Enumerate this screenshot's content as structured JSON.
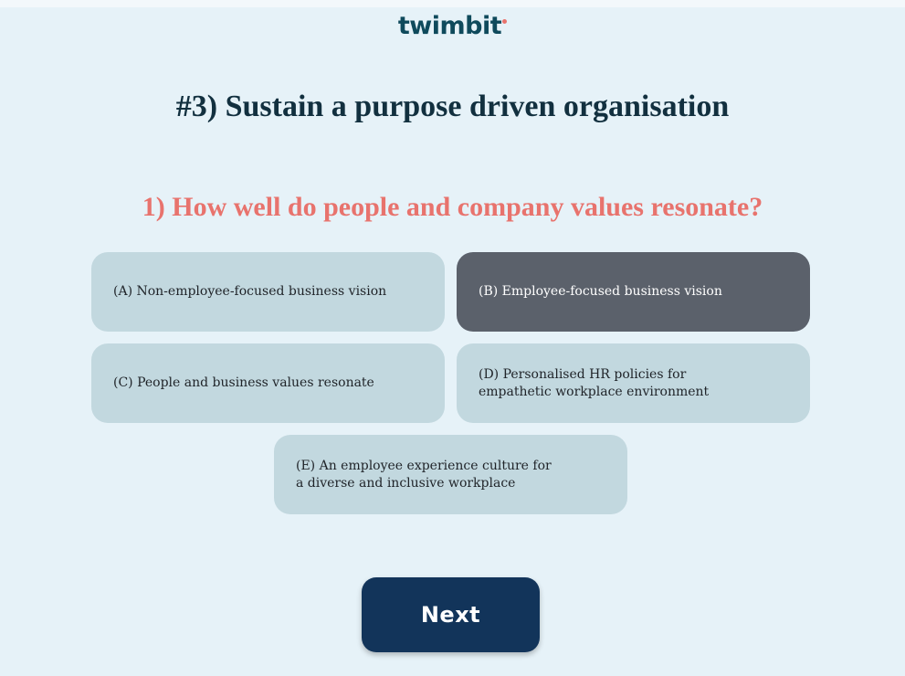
{
  "brand": {
    "logo_text": "twimbit",
    "accent_color": "#e8736d",
    "logo_color": "#0f4a5c"
  },
  "header": {
    "title": "#3) Sustain a purpose driven organisation"
  },
  "question": {
    "text": "1) How well do people and company values resonate?"
  },
  "options": [
    {
      "label": "(A) Non-employee-focused business vision",
      "selected": false
    },
    {
      "label": "(B) Employee-focused business vision",
      "selected": true
    },
    {
      "label": "(C) People and business values resonate",
      "selected": false
    },
    {
      "label": "(D) Personalised HR policies for empathetic workplace environment",
      "selected": false
    },
    {
      "label": "(E) An employee experience culture for a diverse and inclusive workplace",
      "selected": false
    }
  ],
  "actions": {
    "next_label": "Next"
  },
  "colors": {
    "background": "#e6f2f8",
    "option_background": "#c2d8df",
    "option_selected_background": "#5b616b",
    "title_color": "#12303f",
    "question_color": "#e8736d",
    "next_button_background": "#12345a"
  }
}
